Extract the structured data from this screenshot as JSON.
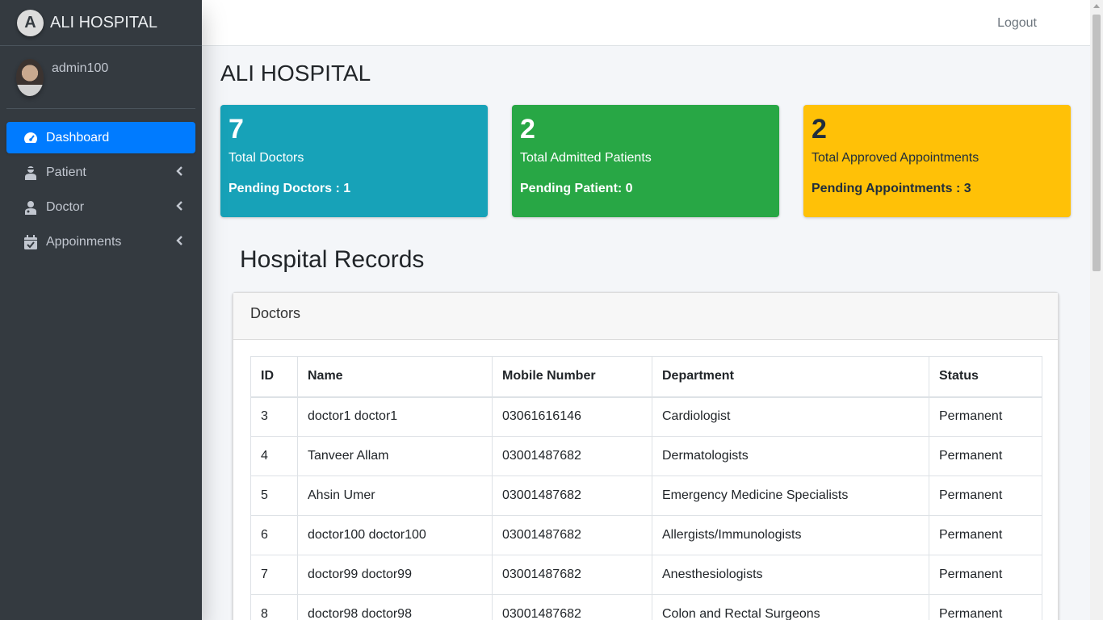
{
  "brand": {
    "name": "ALI HOSPITAL",
    "logo_letter": "A"
  },
  "user": {
    "name": "admin100"
  },
  "sidebar": {
    "items": [
      {
        "label": "Dashboard",
        "icon": "tachometer-icon",
        "active": true
      },
      {
        "label": "Patient",
        "icon": "user-injured-icon"
      },
      {
        "label": "Doctor",
        "icon": "user-md-icon"
      },
      {
        "label": "Appoinments",
        "icon": "calendar-check-icon"
      }
    ]
  },
  "topbar": {
    "logout_label": "Logout"
  },
  "page": {
    "title": "ALI HOSPITAL",
    "records_title": "Hospital Records"
  },
  "stats": {
    "doctors": {
      "value": "7",
      "label": "Total Doctors",
      "pending": "Pending Doctors : 1",
      "color": "#17a2b8"
    },
    "patients": {
      "value": "2",
      "label": "Total Admitted Patients",
      "pending": "Pending Patient: 0",
      "color": "#28a745"
    },
    "appointments": {
      "value": "2",
      "label": "Total Approved Appointments",
      "pending": "Pending Appointments : 3",
      "color": "#ffc107"
    }
  },
  "doctors_card": {
    "title": "Doctors",
    "columns": [
      "ID",
      "Name",
      "Mobile Number",
      "Department",
      "Status"
    ],
    "rows": [
      [
        "3",
        "doctor1 doctor1",
        "03061616146",
        "Cardiologist",
        "Permanent"
      ],
      [
        "4",
        "Tanveer Allam",
        "03001487682",
        "Dermatologists",
        "Permanent"
      ],
      [
        "5",
        "Ahsin Umer",
        "03001487682",
        "Emergency Medicine Specialists",
        "Permanent"
      ],
      [
        "6",
        "doctor100 doctor100",
        "03001487682",
        "Allergists/Immunologists",
        "Permanent"
      ],
      [
        "7",
        "doctor99 doctor99",
        "03001487682",
        "Anesthesiologists",
        "Permanent"
      ],
      [
        "8",
        "doctor98 doctor98",
        "03001487682",
        "Colon and Rectal Surgeons",
        "Permanent"
      ]
    ]
  },
  "colors": {
    "sidebar": "#343a40",
    "active": "#007bff",
    "content_bg": "#f4f6f9"
  }
}
